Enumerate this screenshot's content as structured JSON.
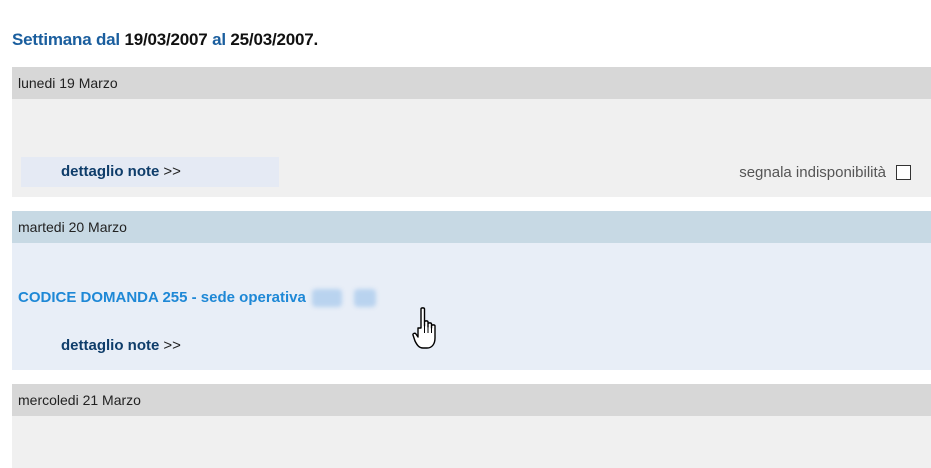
{
  "header": {
    "prefix": "Settimana dal",
    "start_date": "19/03/2007",
    "connector": "al",
    "end_date": "25/03/2007."
  },
  "days": [
    {
      "label": "lunedi 19 Marzo",
      "detail_label": "dettaglio note",
      "detail_arrows": ">>",
      "unavailability_label": "segnala indisponibilità",
      "unavailability_checked": false
    },
    {
      "label": "martedi 20 Marzo",
      "appointment_link": "CODICE DOMANDA 255 - sede operativa",
      "detail_label": "dettaglio note",
      "detail_arrows": ">>"
    },
    {
      "label": "mercoledi 21 Marzo"
    }
  ],
  "icons": {
    "cursor": "hand-pointer-icon",
    "checkbox": "checkbox-icon"
  },
  "colors": {
    "title_blue": "#1a5e9e",
    "link_blue": "#1e88d6",
    "header_gray": "#d7d7d7",
    "header_blue": "#c7d9e4",
    "body_gray": "#f0f0f0",
    "body_blue": "#e8eef7"
  }
}
